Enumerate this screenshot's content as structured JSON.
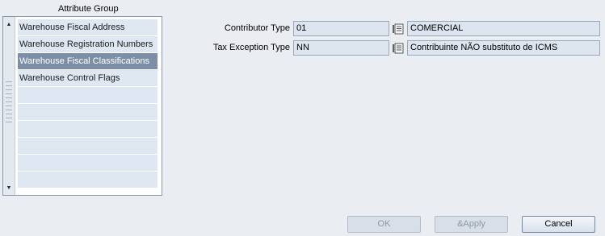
{
  "attribute_group": {
    "title": "Attribute Group",
    "items": [
      {
        "label": "Warehouse Fiscal Address",
        "selected": false
      },
      {
        "label": "Warehouse Registration Numbers",
        "selected": false
      },
      {
        "label": "Warehouse Fiscal Classifications",
        "selected": true
      },
      {
        "label": "Warehouse Control Flags",
        "selected": false
      },
      {
        "label": "",
        "selected": false
      },
      {
        "label": "",
        "selected": false
      },
      {
        "label": "",
        "selected": false
      },
      {
        "label": "",
        "selected": false
      },
      {
        "label": "",
        "selected": false
      },
      {
        "label": "",
        "selected": false
      }
    ]
  },
  "form": {
    "contributor_type": {
      "label": "Contributor Type",
      "code": "01",
      "description": "COMERCIAL",
      "lov_icon": "list-of-values-icon"
    },
    "tax_exception_type": {
      "label": "Tax Exception Type",
      "code": "NN",
      "description": "Contribuinte NÃO substituto de ICMS",
      "lov_icon": "list-of-values-icon"
    }
  },
  "buttons": {
    "ok": {
      "label": "OK",
      "enabled": false
    },
    "apply": {
      "label": "&Apply",
      "enabled": false
    },
    "cancel": {
      "label": "Cancel",
      "enabled": true
    }
  },
  "colors": {
    "background": "#eaeef3",
    "field_background": "#dde5f0",
    "list_item": "#dfe7f2",
    "list_selected": "#7d8fa6"
  }
}
